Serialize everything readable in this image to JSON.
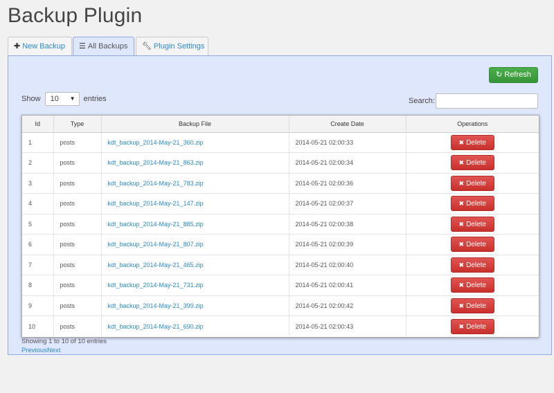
{
  "page_title": "Backup Plugin",
  "tabs": [
    {
      "label": "New Backup",
      "icon": "plus-icon"
    },
    {
      "label": "All Backups",
      "icon": "list-icon"
    },
    {
      "label": "Plugin Settings",
      "icon": "wrench-icon"
    }
  ],
  "toolbar": {
    "refresh_label": "Refresh"
  },
  "length_menu": {
    "prefix": "Show",
    "value": "10",
    "suffix": "entries"
  },
  "search": {
    "label": "Search:",
    "value": ""
  },
  "table": {
    "headers": [
      "Id",
      "Type",
      "Backup File",
      "Create Date",
      "Operations"
    ],
    "delete_label": "Delete",
    "rows": [
      {
        "id": "1",
        "type": "posts",
        "file": "kdt_backup_2014-May-21_360.zip",
        "date": "2014-05-21 02:00:33"
      },
      {
        "id": "2",
        "type": "posts",
        "file": "kdt_backup_2014-May-21_863.zip",
        "date": "2014-05-21 02:00:34"
      },
      {
        "id": "3",
        "type": "posts",
        "file": "kdt_backup_2014-May-21_783.zip",
        "date": "2014-05-21 02:00:36"
      },
      {
        "id": "4",
        "type": "posts",
        "file": "kdt_backup_2014-May-21_147.zip",
        "date": "2014-05-21 02:00:37"
      },
      {
        "id": "5",
        "type": "posts",
        "file": "kdt_backup_2014-May-21_885.zip",
        "date": "2014-05-21 02:00:38"
      },
      {
        "id": "6",
        "type": "posts",
        "file": "kdt_backup_2014-May-21_807.zip",
        "date": "2014-05-21 02:00:39"
      },
      {
        "id": "7",
        "type": "posts",
        "file": "kdt_backup_2014-May-21_465.zip",
        "date": "2014-05-21 02:00:40"
      },
      {
        "id": "8",
        "type": "posts",
        "file": "kdt_backup_2014-May-21_731.zip",
        "date": "2014-05-21 02:00:41"
      },
      {
        "id": "9",
        "type": "posts",
        "file": "kdt_backup_2014-May-21_399.zip",
        "date": "2014-05-21 02:00:42"
      },
      {
        "id": "10",
        "type": "posts",
        "file": "kdt_backup_2014-May-21_690.zip",
        "date": "2014-05-21 02:00:43"
      }
    ]
  },
  "footer": {
    "info": "Showing 1 to 10 of 10 entries",
    "previous": "Previous",
    "next": "Next"
  },
  "colors": {
    "panel_bg": "#dfe7fd",
    "refresh": "#3da046",
    "delete": "#d9534f",
    "link": "#2b8ac6"
  }
}
